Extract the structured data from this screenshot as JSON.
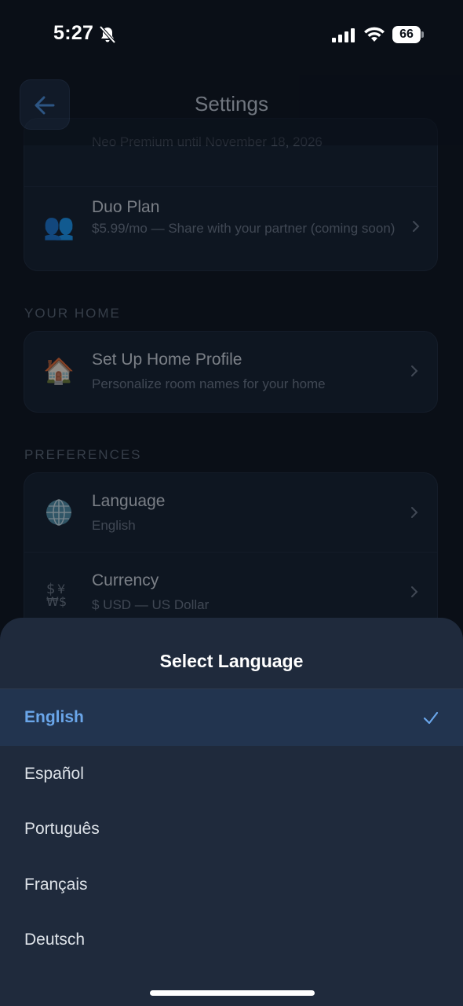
{
  "status_bar": {
    "time": "5:27",
    "battery": "66"
  },
  "header": {
    "title": "Settings"
  },
  "plans": {
    "partial_text": "Neo Premium until November 18, 2026",
    "duo": {
      "title": "Duo Plan",
      "subtitle": "$5.99/mo — Share with your partner (coming soon)",
      "icon": "👥"
    }
  },
  "your_home": {
    "section_label": "YOUR HOME",
    "items": [
      {
        "title": "Set Up Home Profile",
        "subtitle": "Personalize room names for your home",
        "icon": "🏠"
      }
    ]
  },
  "preferences": {
    "section_label": "PREFERENCES",
    "items": [
      {
        "title": "Language",
        "subtitle": "English",
        "icon": "globe-icon"
      },
      {
        "title": "Currency",
        "subtitle": "$ USD — US Dollar",
        "icon": "currency-exchange-icon"
      }
    ]
  },
  "language_sheet": {
    "title": "Select Language",
    "selected": "English",
    "options": [
      "English",
      "Español",
      "Português",
      "Français",
      "Deutsch"
    ],
    "accent_color": "#6aa6ea"
  }
}
